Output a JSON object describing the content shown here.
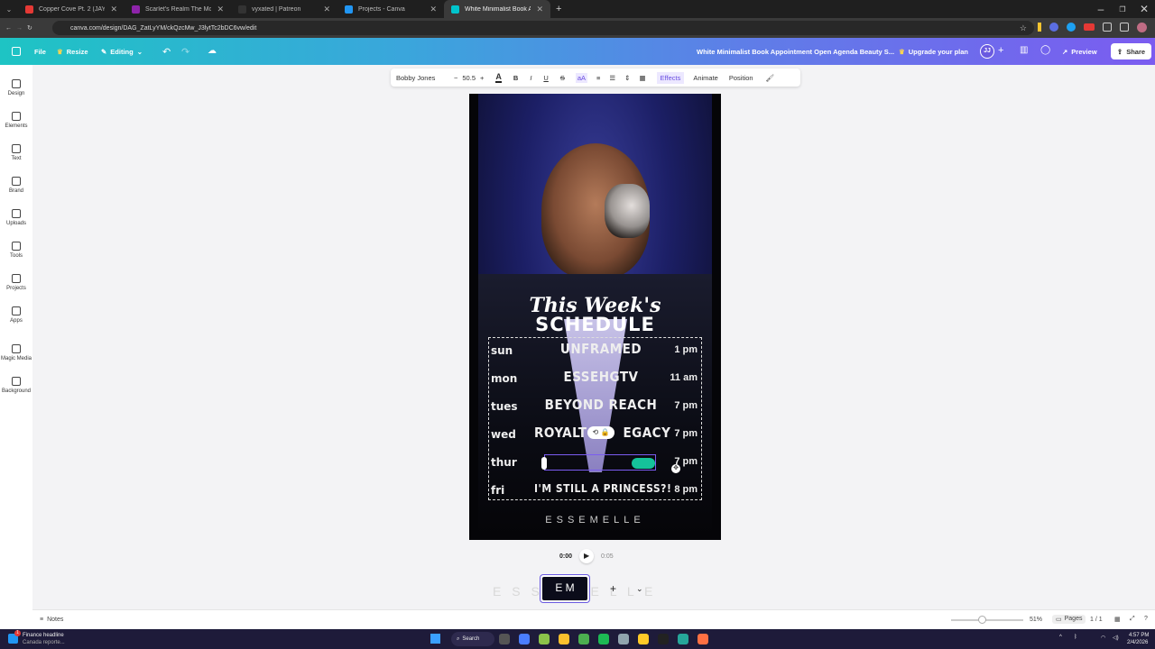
{
  "tabs": [
    {
      "label": "Copper Cove Pt. 2 (JAYBear",
      "color": "#e53935"
    },
    {
      "label": "Scarlet's Realm The Mod List [",
      "color": "#8e24aa"
    },
    {
      "label": "vyxated | Patreon",
      "color": "#333333"
    },
    {
      "label": "Projects - Canva",
      "color": "#2196f3"
    },
    {
      "label": "White Minimalist Book Appoin",
      "color": "#00c4cc"
    }
  ],
  "url": "canva.com/design/DAG_ZatLyYM/ckQzcMw_J3lytTc2bDC6vw/edit",
  "header": {
    "file": "File",
    "resize": "Resize",
    "editing": "Editing",
    "title": "White Minimalist Book Appointment Open Agenda Beauty S...",
    "upgrade": "Upgrade your plan",
    "avatar": "JJ",
    "preview": "Preview",
    "share": "Share"
  },
  "sidebar": [
    {
      "label": "Design"
    },
    {
      "label": "Elements"
    },
    {
      "label": "Text"
    },
    {
      "label": "Brand"
    },
    {
      "label": "Uploads"
    },
    {
      "label": "Tools"
    },
    {
      "label": "Projects"
    },
    {
      "label": "Apps"
    },
    {
      "label": "Magic Media"
    },
    {
      "label": "Background"
    }
  ],
  "toolbar": {
    "font": "Bobby Jones",
    "minus": "−",
    "size": "50.5",
    "plus": "+",
    "color_a": "A",
    "bold": "B",
    "italic": "I",
    "underline": "U",
    "strike": "S",
    "case": "aA",
    "effects": "Effects",
    "animate": "Animate",
    "position": "Position"
  },
  "design": {
    "title_script": "This Week's",
    "title_main": "SCHEDULE",
    "brand": "ESSEMELLE",
    "schedule": [
      {
        "day": "sun",
        "show": "UNFRAMED",
        "time": "1 pm"
      },
      {
        "day": "mon",
        "show": "ESSEHGTV",
        "time": "11 am"
      },
      {
        "day": "tues",
        "show": "BEYOND REACH",
        "time": "7 pm"
      },
      {
        "day": "wed",
        "show": "ROYALT",
        "show_end": "EGACY",
        "time": "7 pm"
      },
      {
        "day": "thur",
        "show": "",
        "time": "7 pm"
      },
      {
        "day": "fri",
        "show": "I'M STILL A PRINCESS?!",
        "time": "8 pm"
      }
    ]
  },
  "playback": {
    "current": "0:00",
    "total": "0:05"
  },
  "timeline": {
    "ghost": "E S S E M E L L E",
    "thumb": "E M"
  },
  "status": {
    "notes": "Notes",
    "zoom": "51%",
    "pages": "Pages",
    "page_count": "1 / 1"
  },
  "taskbar": {
    "news_title": "Finance headline",
    "news_sub": "Canada reporte...",
    "search": "Search",
    "time": "4:57 PM",
    "date": "2/4/2026",
    "badge": "1"
  }
}
